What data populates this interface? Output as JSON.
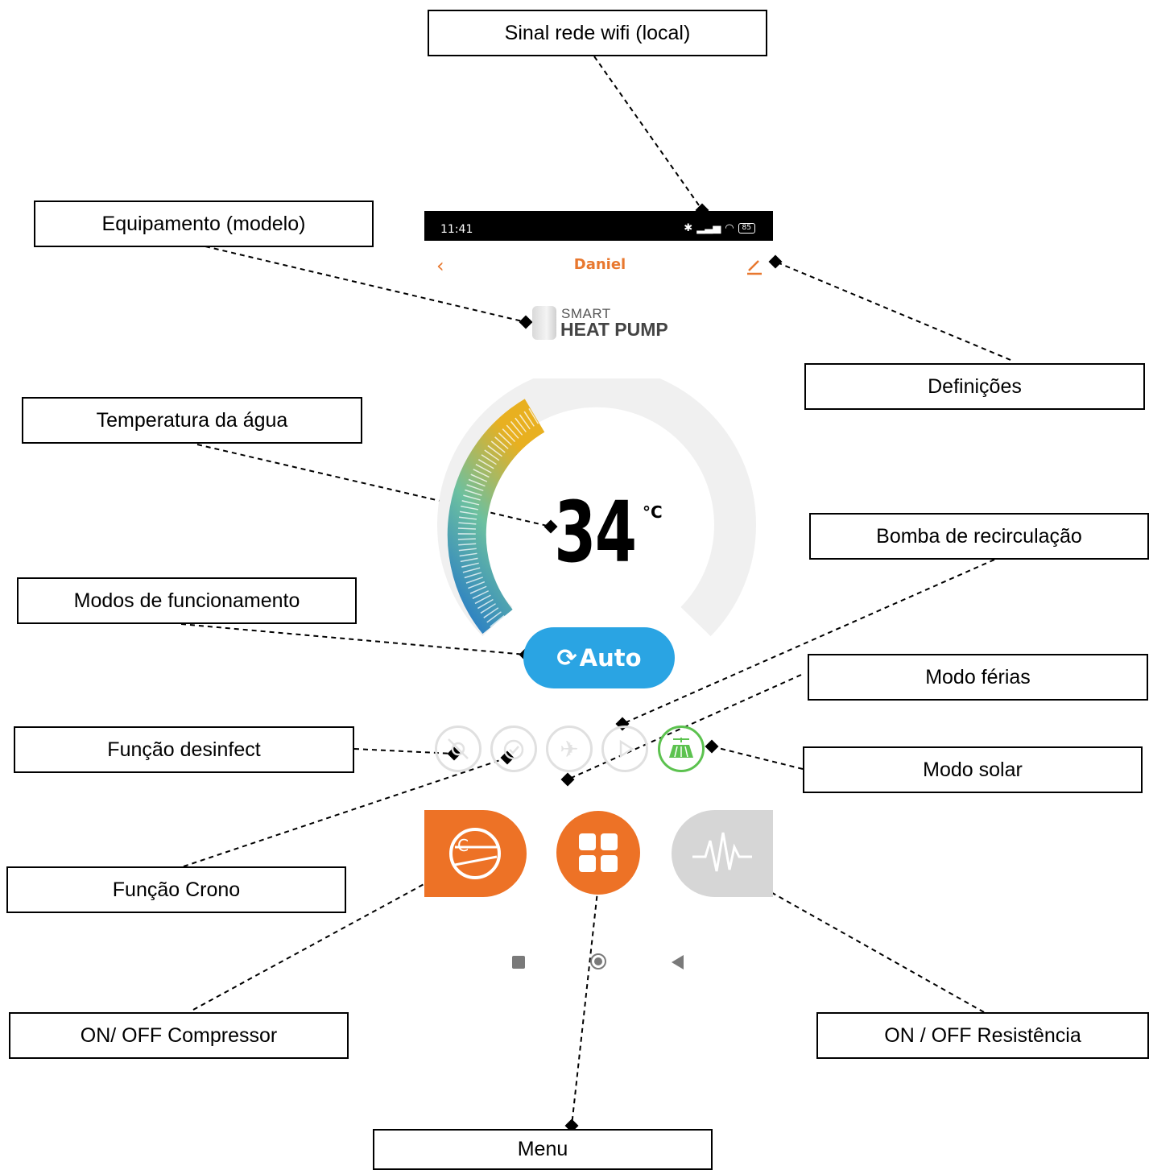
{
  "callouts": {
    "wifi": "Sinal rede wifi (local)",
    "equipment": "Equipamento (modelo)",
    "settings": "Definições",
    "water_temp": "Temperatura da água",
    "recirculation_pump": "Bomba de recirculação",
    "operating_modes": "Modos de funcionamento",
    "holiday_mode": "Modo férias",
    "disinfect": "Função desinfect",
    "solar_mode": "Modo solar",
    "crono": "Função Crono",
    "compressor": "ON/ OFF Compressor",
    "resistance": "ON / OFF Resistência",
    "menu": "Menu"
  },
  "phone": {
    "status_time": "11:41",
    "battery": "85",
    "title": "Daniel",
    "brand_small": "SMART",
    "brand_big": "HEAT PUMP",
    "temperature": "34",
    "temperature_unit": "°C",
    "mode_label": "Auto",
    "gauge_fill_fraction": 0.3
  },
  "colors": {
    "accent_orange": "#ed7226",
    "mode_blue": "#2aa4e3",
    "solar_green": "#5cc24f",
    "inactive_gray": "#d6d6d6"
  },
  "icons": [
    "back-icon",
    "edit-icon",
    "disinfect-icon",
    "alarm-clock-icon",
    "airplane-icon",
    "play-icon",
    "solar-panel-icon",
    "compressor-icon",
    "grid-menu-icon",
    "waveform-icon"
  ]
}
